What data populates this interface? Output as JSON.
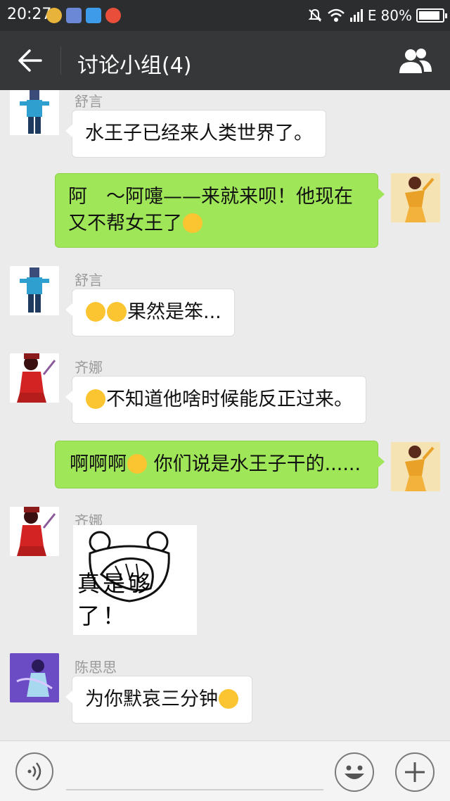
{
  "status_bar": {
    "time": "20:27",
    "network": "E",
    "battery": "80%"
  },
  "title_bar": {
    "title": "讨论小组(4)"
  },
  "messages": [
    {
      "side": "left",
      "sender": "舒言",
      "text": "水王子已经来人类世界了。"
    },
    {
      "side": "right",
      "text_line1": "阿　～阿嚏——来就来呗！他现在",
      "text_line2": "又不帮女王了"
    },
    {
      "side": "left",
      "sender": "舒言",
      "text": "果然是笨..."
    },
    {
      "side": "left",
      "sender": "齐娜",
      "text": "不知道他啥时候能反正过来。"
    },
    {
      "side": "right",
      "text_pre": "啊啊啊",
      "text_post": " 你们说是水王子干的......"
    },
    {
      "side": "left",
      "sender": "齐娜",
      "sticker_text": "真是够了！"
    },
    {
      "side": "left",
      "sender": "陈思思",
      "text": "为你默哀三分钟"
    }
  ],
  "input": {
    "placeholder": ""
  },
  "colors": {
    "my_bubble": "#9fe658",
    "their_bubble": "#ffffff",
    "title_bar": "#353738",
    "status_bar": "#2b2d2f",
    "background": "#ebebeb"
  }
}
